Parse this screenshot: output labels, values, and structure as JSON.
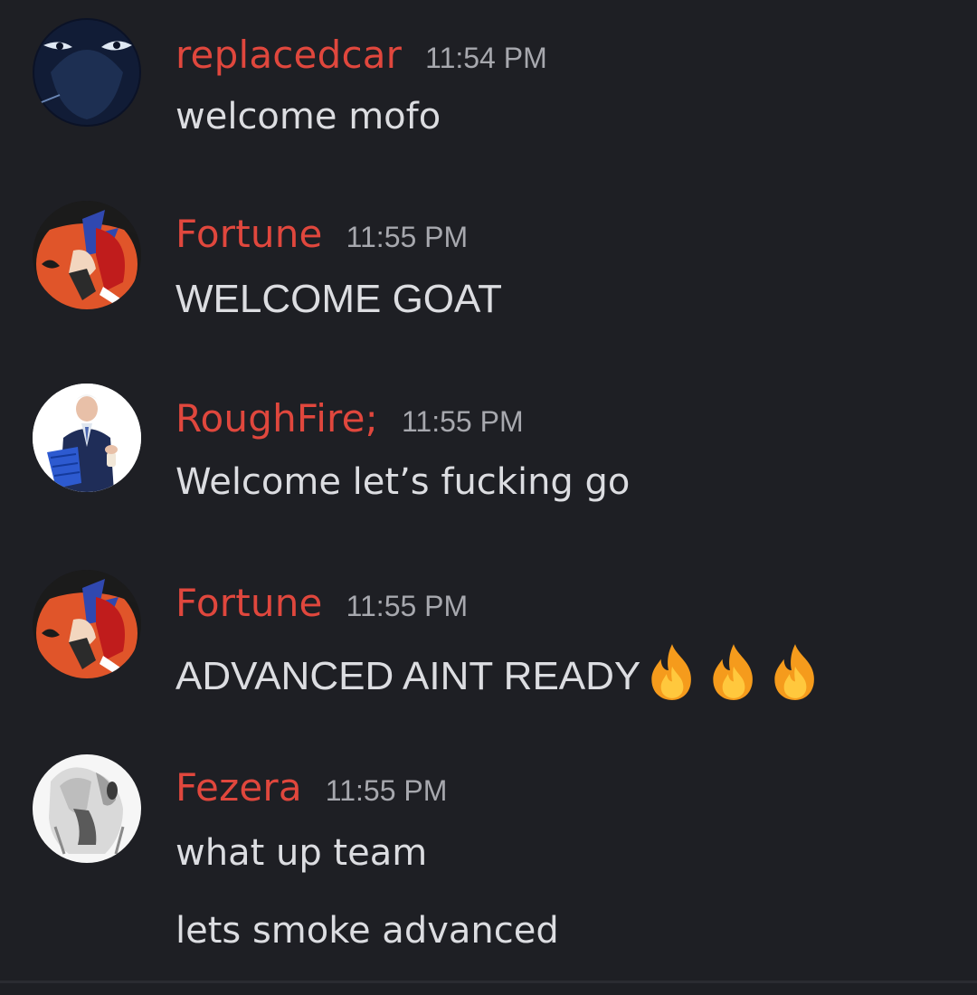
{
  "theme": {
    "background": "#1e1f24",
    "username_color": "#e0473d",
    "timestamp_color": "#a7a8ae",
    "text_color": "#dcdde1"
  },
  "messages": [
    {
      "username": "replacedcar",
      "time": "11:54 PM",
      "avatar_icon": "dark-anime-face-avatar",
      "lines": [
        "welcome mofo"
      ]
    },
    {
      "username": "Fortune",
      "time": "11:55 PM",
      "avatar_icon": "red-anime-character-avatar",
      "lines": [
        "WELCOME GOAT"
      ]
    },
    {
      "username": "RoughFire;",
      "time": "11:55 PM",
      "avatar_icon": "man-in-suit-avatar",
      "lines": [
        "Welcome let’s fucking go"
      ]
    },
    {
      "username": "Fortune",
      "time": "11:55 PM",
      "avatar_icon": "red-anime-character-avatar",
      "lines": [
        "ADVANCED AINT READY"
      ],
      "emoji": [
        "fire-emoji",
        "fire-emoji",
        "fire-emoji"
      ]
    },
    {
      "username": "Fezera",
      "time": "11:55 PM",
      "avatar_icon": "grayscale-anime-avatar",
      "lines": [
        "what up team",
        "lets smoke advanced"
      ]
    }
  ]
}
